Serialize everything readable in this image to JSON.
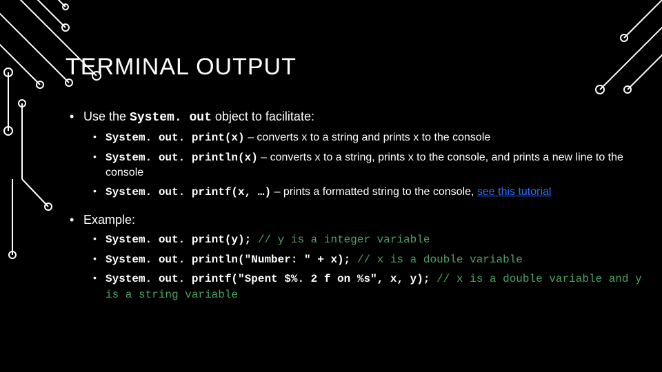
{
  "title": "TERMINAL OUTPUT",
  "section1": {
    "lead_pre": "Use the ",
    "lead_code": "System. out",
    "lead_post": " object to facilitate:",
    "items": [
      {
        "code": "System. out. print(x)",
        "desc": " – converts x to a string and prints x to the console"
      },
      {
        "code": "System. out. println(x)",
        "desc": " – converts x to a string, prints x to the console, and prints a new line to the console"
      },
      {
        "code": "System. out. printf(x, …)",
        "desc": " – prints a formatted string to the console, ",
        "link": "see this tutorial"
      }
    ]
  },
  "section2": {
    "lead": "Example:",
    "items": [
      {
        "code": "System. out. print(y); ",
        "comment": "// y is a integer variable"
      },
      {
        "code": "System. out. println(\"Number: \" + x); ",
        "comment": "// x is a double variable"
      },
      {
        "code": "System. out. printf(\"Spent $%. 2 f on %s\", x, y); ",
        "comment": "// x is a double variable and y is a string variable"
      }
    ]
  }
}
